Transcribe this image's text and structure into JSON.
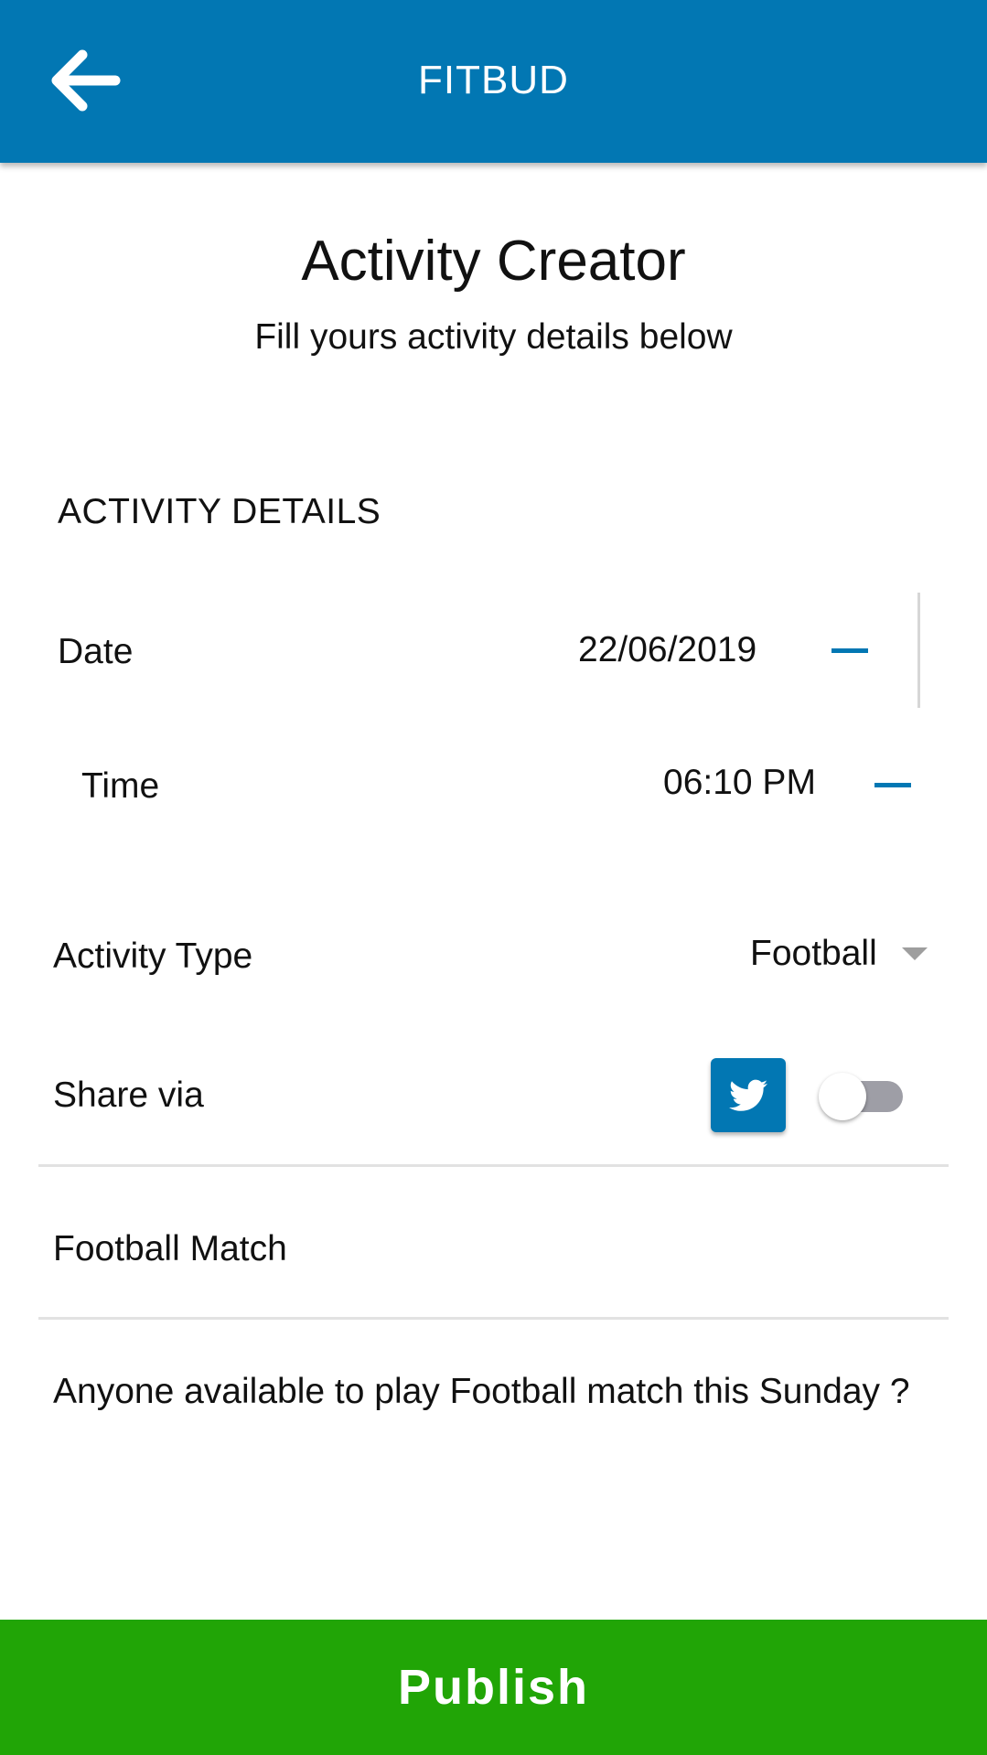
{
  "app_bar": {
    "title": "FITBUD",
    "back_icon": "arrow-left-icon",
    "background": "#0277b3"
  },
  "header": {
    "title": "Activity Creator",
    "subtitle": "Fill yours activity details below"
  },
  "section": {
    "title": "ACTIVITY DETAILS"
  },
  "fields": {
    "date": {
      "label": "Date",
      "value": "22/06/2019"
    },
    "time": {
      "label": "Time",
      "value": "06:10 PM"
    },
    "activity_type": {
      "label": "Activity Type",
      "value": "Football"
    },
    "share": {
      "label": "Share via",
      "icon": "twitter-icon",
      "toggle_on": false
    },
    "title_field": {
      "value": "Football Match"
    },
    "description": {
      "value": "Anyone available to play Football match this Sunday ?"
    }
  },
  "publish": {
    "label": "Publish",
    "background": "#21a506"
  }
}
